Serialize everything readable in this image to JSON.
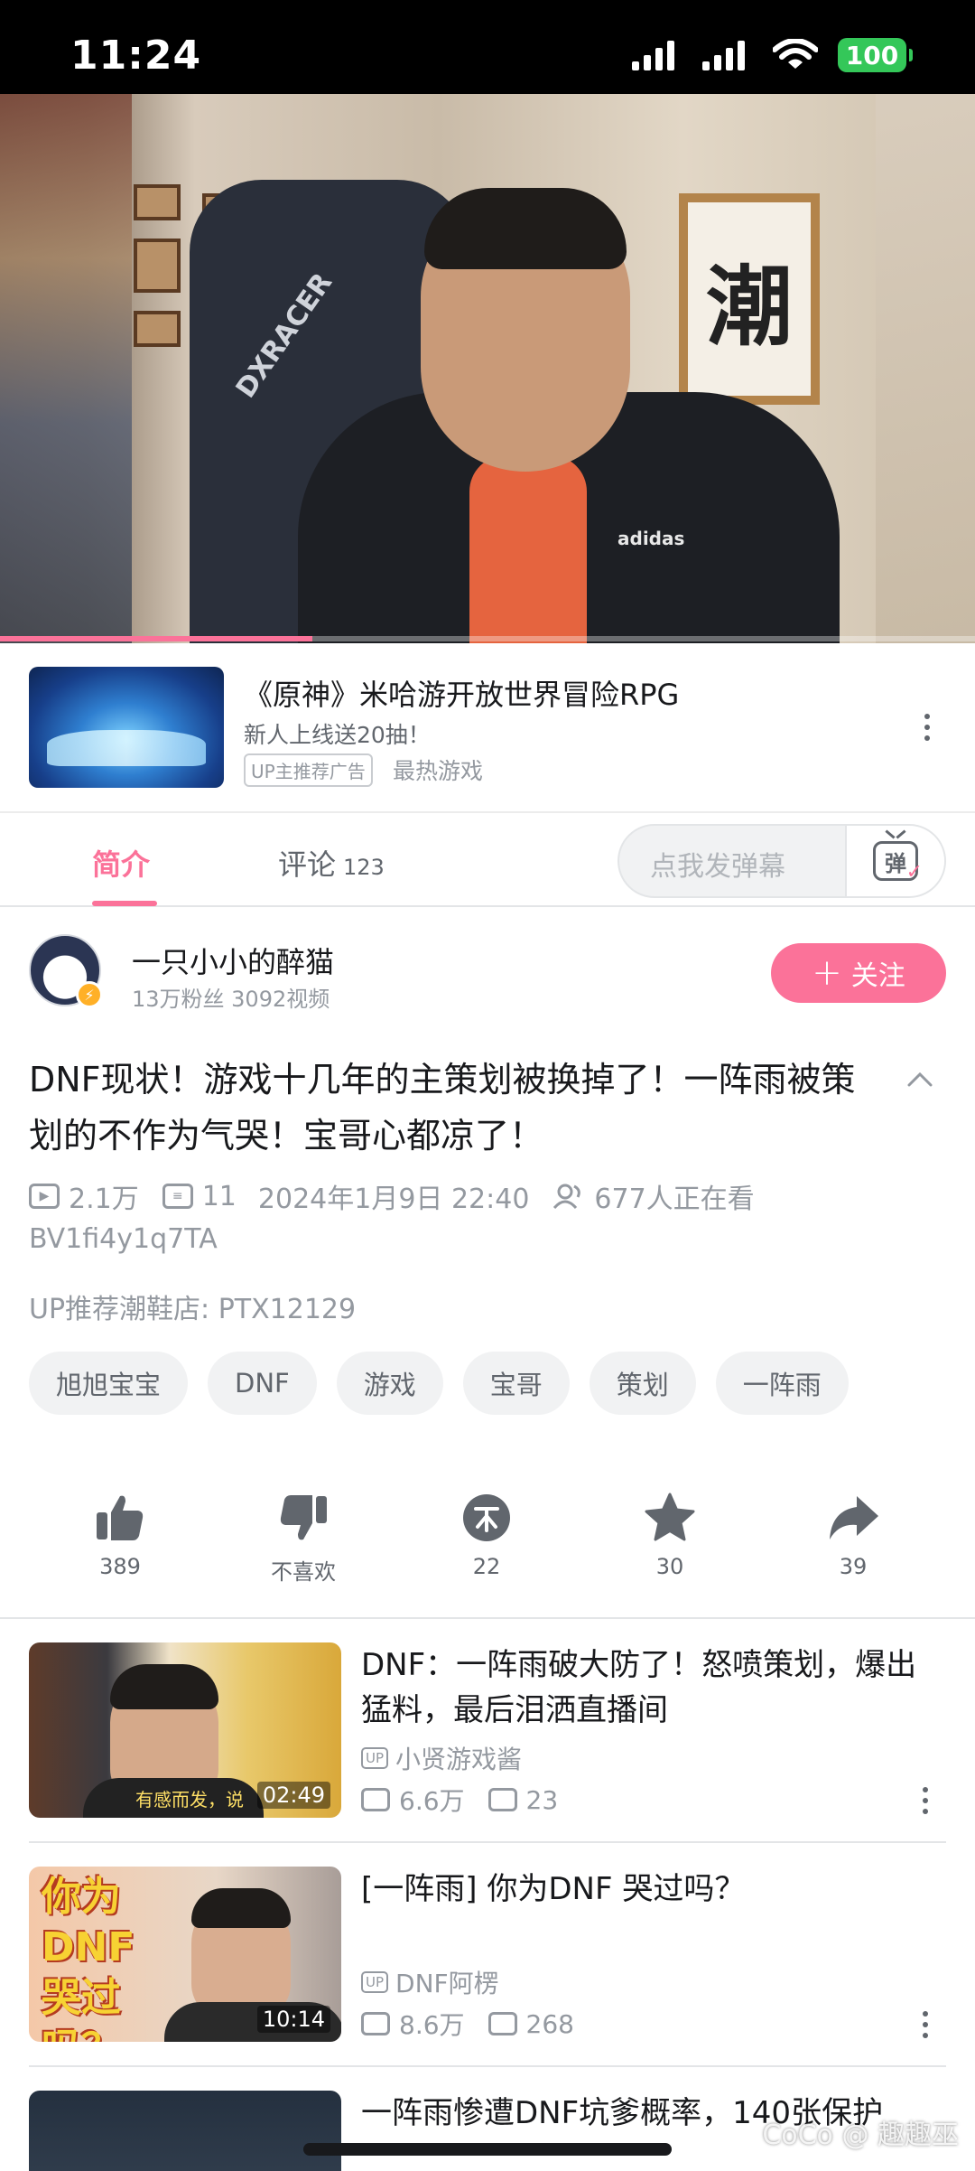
{
  "status_bar": {
    "time": "11:24",
    "battery": "100"
  },
  "player": {
    "progress_fraction": 0.32,
    "calligraphy": "潮",
    "chair_brand": "DXRACER",
    "shirt_brand": "adidas"
  },
  "ad": {
    "title": "《原神》米哈游开放世界冒险RPG",
    "description": "新人上线送20抽！",
    "tag": "UP主推荐广告",
    "category": "最热游戏"
  },
  "tabs": {
    "intro": "简介",
    "comments": "评论",
    "comments_count": "123",
    "danmaku_placeholder": "点我发弹幕",
    "danmaku_button": "弹"
  },
  "uploader": {
    "name": "一只小小的醉猫",
    "stats": "13万粉丝   3092视频",
    "follow": "关注"
  },
  "video": {
    "title": "DNF现状！游戏十几年的主策划被换掉了！一阵雨被策划的不作为气哭！宝哥心都凉了！",
    "views": "2.1万",
    "danmaku": "11",
    "date": "2024年1月9日 22:40",
    "watching": "677人正在看",
    "bvid": "BV1fi4y1q7TA",
    "promo": "UP推荐潮鞋店: PTX12129"
  },
  "tags": [
    "旭旭宝宝",
    "DNF",
    "游戏",
    "宝哥",
    "策划",
    "一阵雨"
  ],
  "actions": {
    "like": "389",
    "dislike": "不喜欢",
    "coin": "22",
    "favorite": "30",
    "share": "39"
  },
  "related": [
    {
      "title": "DNF：一阵雨破大防了！怒喷策划，爆出猛料，最后泪洒直播间",
      "up": "小贤游戏酱",
      "views": "6.6万",
      "danmaku": "23",
      "duration": "02:49",
      "thumb_caption": "有感而发，说"
    },
    {
      "title": "[一阵雨] 你为DNF 哭过吗？",
      "up": "DNF阿楞",
      "views": "8.6万",
      "danmaku": "268",
      "duration": "10:14",
      "thumb_caption": "你为 DNF 哭过吗？"
    },
    {
      "title": "一阵雨惨遭DNF坑爹概率，140张保护",
      "up": "",
      "views": "",
      "danmaku": "",
      "duration": "",
      "thumb_caption": ""
    }
  ],
  "watermark": "CoCo @ 趣趣巫",
  "colors": {
    "accent": "#fb7299",
    "text": "#18191c",
    "secondary": "#9499a0",
    "battery": "#34c759"
  }
}
